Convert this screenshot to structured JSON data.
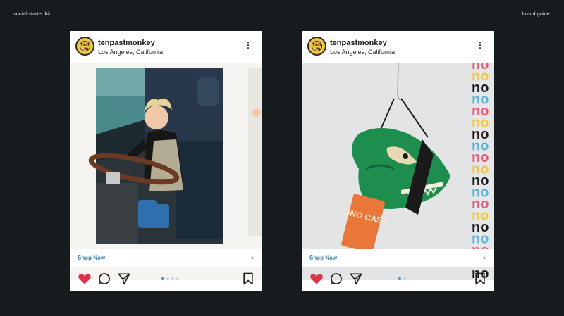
{
  "header": {
    "left_label": "social starter kit",
    "right_label": "brand guide"
  },
  "posts": [
    {
      "username": "tenpastmonkey",
      "location": "Los Angeles, California",
      "avatar_text_top": "ten",
      "avatar_text_bottom": "m",
      "more_icon": "⋮",
      "cta_label": "Shop Now",
      "cta_chevron": "›",
      "carousel_total": 4,
      "carousel_active": 1,
      "image_subject": "Child in hoodie and blue boots steering a boat wheel"
    },
    {
      "username": "tenpastmonkey",
      "location": "Los Angeles, California",
      "avatar_text_top": "ten",
      "avatar_text_bottom": "m",
      "more_icon": "⋮",
      "cta_label": "Shop Now",
      "cta_chevron": "›",
      "carousel_total": 2,
      "carousel_active": 1,
      "image_subject": "Green dinosaur head case hanging on a wire with an orange tag",
      "tag_text": "DINO CASE",
      "pattern_text": "no"
    }
  ],
  "colors": {
    "background": "#161c1e",
    "heart": "#e0334a",
    "link": "#3f7fb1",
    "dot_active": "#3f8fd3"
  },
  "icons": [
    "heart-icon",
    "comment-icon",
    "share-icon",
    "bookmark-icon",
    "more-icon"
  ]
}
